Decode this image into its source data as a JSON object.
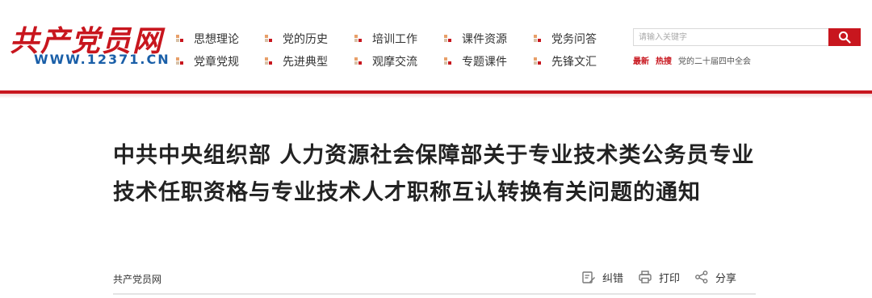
{
  "site": {
    "logo_text": "共产党员网",
    "url": "WWW.12371.CN"
  },
  "nav": {
    "row1": [
      "思想理论",
      "党的历史",
      "培训工作",
      "课件资源",
      "党务问答"
    ],
    "row2": [
      "党章党规",
      "先进典型",
      "观摩交流",
      "专题课件",
      "先锋文汇"
    ]
  },
  "search": {
    "placeholder": "请输入关键字"
  },
  "quick_links": {
    "latest": "最新",
    "hot": "热搜",
    "topic": "党的二十届四中全会"
  },
  "article": {
    "title": "中共中央组织部 人力资源社会保障部关于专业技术类公务员专业技术任职资格与专业技术人才职称互认转换有关问题的通知",
    "source": "共产党员网",
    "actions": {
      "correct": "纠错",
      "print": "打印",
      "share": "分享"
    }
  },
  "colors": {
    "brand_red": "#c8161e",
    "url_blue": "#1a5fa8"
  }
}
